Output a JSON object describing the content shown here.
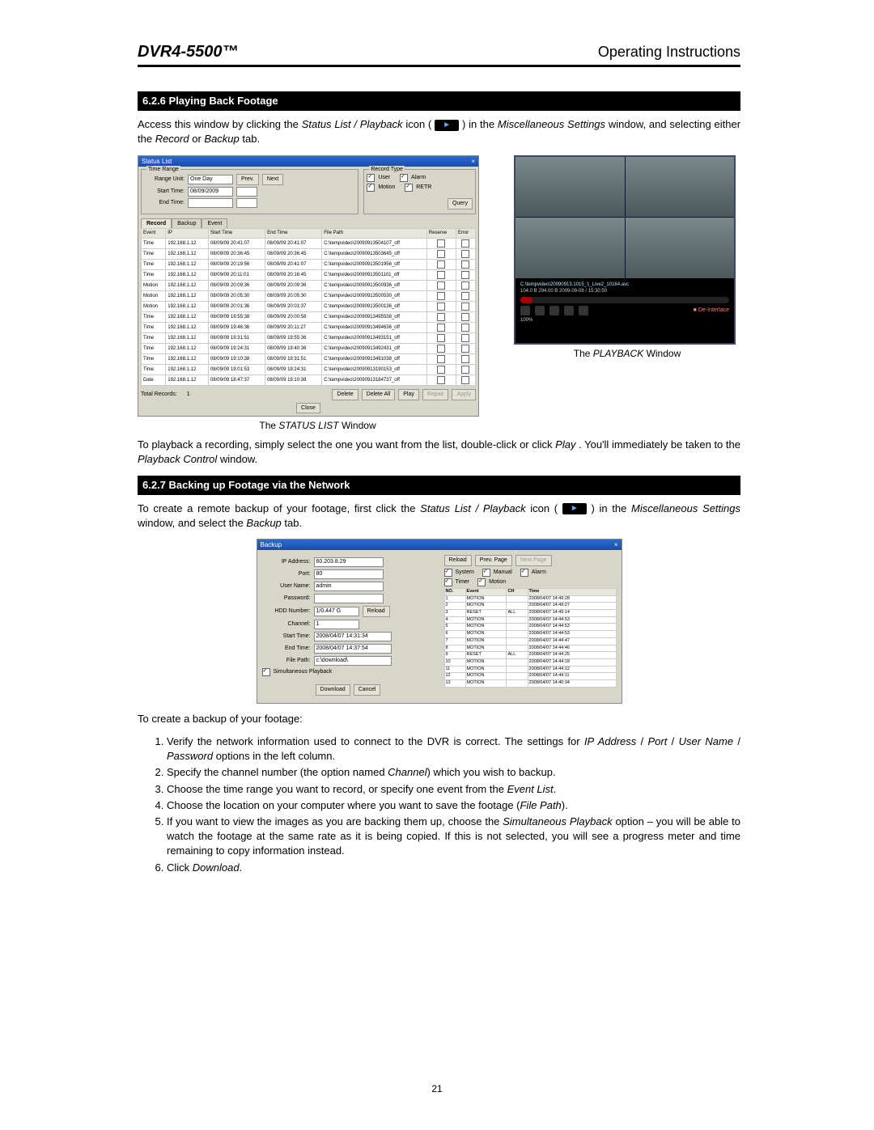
{
  "header": {
    "left": "DVR4-5500™",
    "right": "Operating Instructions"
  },
  "section1": {
    "title": "6.2.6 Playing Back Footage",
    "intro_a": "Access this window by clicking the ",
    "intro_b": "Status List / Playback",
    "intro_c": " icon (",
    "intro_d": ") in the ",
    "intro_e": "Miscellaneous Settings",
    "intro_f": " window, and selecting either the ",
    "intro_g": "Record",
    "intro_h": " or ",
    "intro_i": "Backup",
    "intro_j": " tab."
  },
  "statusWin": {
    "title": "Status List",
    "timeRange": "Time Range",
    "rangeUnit": "Range Unit:",
    "rangeUnitVal": "One Day",
    "prev": "Prev.",
    "next": "Next",
    "startTime": "Start Time:",
    "startTimeVal": "08/09/2009",
    "endTime": "End Time:",
    "recordType": "Record Type",
    "rtUser": "User",
    "rtAlarm": "Alarm",
    "rtMotion": "Motion",
    "rtRETR": "RETR",
    "query": "Query",
    "tabs": {
      "record": "Record",
      "backup": "Backup",
      "event": "Event"
    },
    "cols": {
      "event": "Event",
      "ip": "IP",
      "start": "Start Time",
      "end": "End Time",
      "path": "File Path",
      "r": "Reserve",
      "e": "Error"
    },
    "rows": [
      {
        "ev": "Time",
        "ip": "192.168.1.12",
        "s": "08/09/09 20:41:07",
        "e": "08/09/09 20:41:07",
        "p": "C:\\tempvideo\\20090913504107_off"
      },
      {
        "ev": "Time",
        "ip": "192.168.1.12",
        "s": "08/09/09 20:36:45",
        "e": "08/09/09 20:36:45",
        "p": "C:\\tempvideo\\20090913503645_off"
      },
      {
        "ev": "Time",
        "ip": "192.168.1.12",
        "s": "08/09/09 20:19:56",
        "e": "08/09/09 20:41:07",
        "p": "C:\\tempvideo\\20090913501956_off"
      },
      {
        "ev": "Time",
        "ip": "192.168.1.12",
        "s": "08/09/09 20:11:01",
        "e": "08/09/09 20:16:45",
        "p": "C:\\tempvideo\\20090913501101_off"
      },
      {
        "ev": "Motion",
        "ip": "192.168.1.12",
        "s": "08/09/09 20:09:36",
        "e": "08/09/09 20:09:36",
        "p": "C:\\tempvideo\\20090913500936_off"
      },
      {
        "ev": "Motion",
        "ip": "192.168.1.12",
        "s": "08/09/09 20:05:30",
        "e": "08/09/09 20:05:30",
        "p": "C:\\tempvideo\\20090913500530_off"
      },
      {
        "ev": "Motion",
        "ip": "192.168.1.12",
        "s": "08/09/09 20:01:36",
        "e": "08/09/09 20:01:37",
        "p": "C:\\tempvideo\\20090913500136_off"
      },
      {
        "ev": "Time",
        "ip": "192.168.1.12",
        "s": "08/09/09 19:55:38",
        "e": "08/09/09 20:00:58",
        "p": "C:\\tempvideo\\20090913495538_off"
      },
      {
        "ev": "Time",
        "ip": "192.168.1.12",
        "s": "08/09/09 19:46:36",
        "e": "08/09/09 20:11:27",
        "p": "C:\\tempvideo\\20090913494636_off"
      },
      {
        "ev": "Time",
        "ip": "192.168.1.12",
        "s": "08/09/09 19:31:51",
        "e": "08/09/09 19:55:36",
        "p": "C:\\tempvideo\\20090913493151_off"
      },
      {
        "ev": "Time",
        "ip": "192.168.1.12",
        "s": "08/09/09 19:24:31",
        "e": "08/09/09 19:40:36",
        "p": "C:\\tempvideo\\20090913492431_off"
      },
      {
        "ev": "Time",
        "ip": "192.168.1.12",
        "s": "08/09/09 19:10:38",
        "e": "08/09/09 19:31:51",
        "p": "C:\\tempvideo\\20090913491038_off"
      },
      {
        "ev": "Time",
        "ip": "192.168.1.12",
        "s": "08/09/09 19:01:53",
        "e": "08/09/09 19:24:31",
        "p": "C:\\tempvideo\\20090913190153_off"
      },
      {
        "ev": "Date",
        "ip": "192.168.1.12",
        "s": "08/09/09 18:47:37",
        "e": "08/09/09 19:10:38",
        "p": "C:\\tempvideo\\20090913184737_off"
      }
    ],
    "totalRecordsLabel": "Total Records:",
    "totalRecordsVal": "1",
    "btnDelete": "Delete",
    "btnDeleteAll": "Delete All",
    "btnPlay": "Play",
    "btnRepair": "Repair",
    "btnApply": "Apply",
    "btnClose": "Close"
  },
  "playbackWin": {
    "status": "C:\\tempvideo\\20090913.1015_1_Live2_10164.avc",
    "meta": "104.0 B      294.00 B      2009-09-08 / 15:30:50",
    "deinterlace": "De-Interlace",
    "progress": "100%"
  },
  "captions": {
    "status": "The STATUS LIST Window",
    "playback": "The PLAYBACK Window"
  },
  "playbackPara_a": "To playback a recording, simply select the one you want from the list, double-click or click ",
  "playbackPara_b": "Play",
  "playbackPara_c": ". You'll immediately be taken to the ",
  "playbackPara_d": "Playback Control",
  "playbackPara_e": " window.",
  "section2": {
    "title": "6.2.7 Backing up Footage via the Network",
    "intro_a": "To create a remote backup of your footage, first click the ",
    "intro_b": "Status List / Playback",
    "intro_c": " icon (",
    "intro_d": ") in the ",
    "intro_e": "Miscellaneous Settings",
    "intro_f": " window, and select the ",
    "intro_g": "Backup",
    "intro_h": " tab."
  },
  "backupWin": {
    "title": "Backup",
    "ip": "IP Address:",
    "ipVal": "60.203.8.29",
    "port": "Port:",
    "portVal": "80",
    "user": "User Name:",
    "userVal": "admin",
    "pwd": "Password:",
    "hdd": "HDD Number:",
    "hddVal": "1/0.447 G",
    "reload": "Reload",
    "ch": "Channel:",
    "chVal": "1",
    "stime": "Start Time:",
    "stimeVal": "2008/04/07 14:31:34",
    "etime": "End Time:",
    "etimeVal": "2008/04/07 14:37:54",
    "path": "File Path:",
    "pathVal": "c:\\download\\",
    "simul": "Simultaneous Playback",
    "download": "Download",
    "cancel": "Cancel",
    "cbSystem": "System",
    "cbManual": "Manual",
    "cbAlarm": "Alarm",
    "cbTimer": "Timer",
    "cbMotion": "Motion",
    "prevPage": "Prev. Page",
    "nextPage": "Next Page",
    "cols": {
      "no": "NO.",
      "event": "Event",
      "ch": "CH",
      "time": "Time"
    },
    "rows": [
      {
        "n": "1",
        "ev": "MOTION",
        "ch": "",
        "t": "2008/04/07 14:49:28"
      },
      {
        "n": "2",
        "ev": "MOTION",
        "ch": "",
        "t": "2008/04/07 14:49:27"
      },
      {
        "n": "3",
        "ev": "RESET",
        "ch": "ALL",
        "t": "2008/04/07 14:49:14"
      },
      {
        "n": "4",
        "ev": "MOTION",
        "ch": "",
        "t": "2008/04/07 14:44:53"
      },
      {
        "n": "5",
        "ev": "MOTION",
        "ch": "",
        "t": "2008/04/07 14:44:53"
      },
      {
        "n": "6",
        "ev": "MOTION",
        "ch": "",
        "t": "2008/04/07 14:44:53"
      },
      {
        "n": "7",
        "ev": "MOTION",
        "ch": "",
        "t": "2008/04/07 14:44:47"
      },
      {
        "n": "8",
        "ev": "MOTION",
        "ch": "",
        "t": "2008/04/07 14:44:46"
      },
      {
        "n": "9",
        "ev": "RESET",
        "ch": "ALL",
        "t": "2008/04/07 14:44:25"
      },
      {
        "n": "10",
        "ev": "MOTION",
        "ch": "",
        "t": "2008/04/07 14:44:18"
      },
      {
        "n": "11",
        "ev": "MOTION",
        "ch": "",
        "t": "2008/04/07 14:44:12"
      },
      {
        "n": "12",
        "ev": "MOTION",
        "ch": "",
        "t": "2008/04/07 14:44:11"
      },
      {
        "n": "13",
        "ev": "MOTION",
        "ch": "",
        "t": "2008/04/07 14:40:34"
      }
    ]
  },
  "stepsIntro": "To create a backup of your footage:",
  "steps": {
    "s1a": "Verify the network information used to connect to the DVR is correct. The settings for ",
    "s1b": "IP Address",
    "s1c": " / ",
    "s1d": "Port",
    "s1e": " / ",
    "s1f": "User Name",
    "s1g": " / ",
    "s1h": "Password",
    "s1i": " options in the left column.",
    "s2a": "Specify the channel number (the option named ",
    "s2b": "Channel",
    "s2c": ") which you wish to backup.",
    "s3a": "Choose the time range you want to record, or specify one event from the ",
    "s3b": "Event List",
    "s3c": ".",
    "s4a": "Choose the location on your computer where you want to save the footage (",
    "s4b": "File Path",
    "s4c": ").",
    "s5a": "If you want to view the images as you are backing them up, choose the ",
    "s5b": "Simultaneous Playback",
    "s5c": " option – you will be able to watch the footage at the same rate as it is being copied. If this is not selected, you will see a progress meter and time remaining to copy information instead.",
    "s6a": "Click ",
    "s6b": "Download",
    "s6c": "."
  },
  "pageNum": "21"
}
